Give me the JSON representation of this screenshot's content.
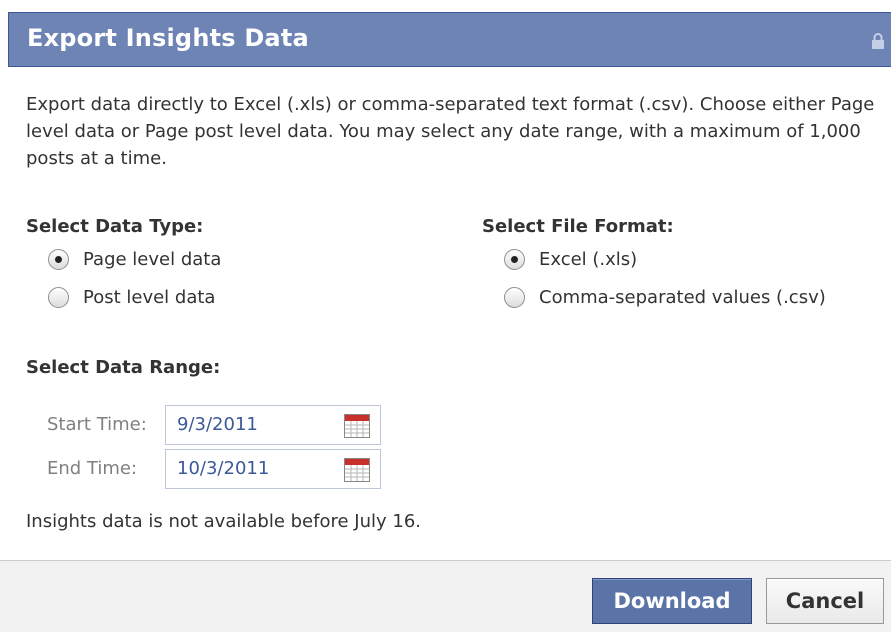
{
  "dialog": {
    "title": "Export Insights Data",
    "lock_icon": "lock-icon",
    "intro": "Export data directly to Excel (.xls) or comma-separated text format (.csv). Choose either Page level data or Page post level data. You may select any date range, with a maximum of 1,000 posts at a time.",
    "data_type": {
      "label": "Select Data Type:",
      "options": [
        {
          "label": "Page level data",
          "checked": true
        },
        {
          "label": "Post level data",
          "checked": false
        }
      ]
    },
    "file_format": {
      "label": "Select File Format:",
      "options": [
        {
          "label": "Excel (.xls)",
          "checked": true
        },
        {
          "label": "Comma-separated values (.csv)",
          "checked": false
        }
      ]
    },
    "date_range": {
      "label": "Select Data Range:",
      "start_label": "Start Time:",
      "start_value": "9/3/2011",
      "end_label": "End Time:",
      "end_value": "10/3/2011",
      "calendar_icon": "calendar-icon"
    },
    "note": "Insights data is not available before July 16.",
    "buttons": {
      "download": "Download",
      "cancel": "Cancel"
    },
    "colors": {
      "titlebar": "#6d84b4",
      "primary_button": "#5b74a8",
      "link_text": "#3b5998"
    }
  }
}
